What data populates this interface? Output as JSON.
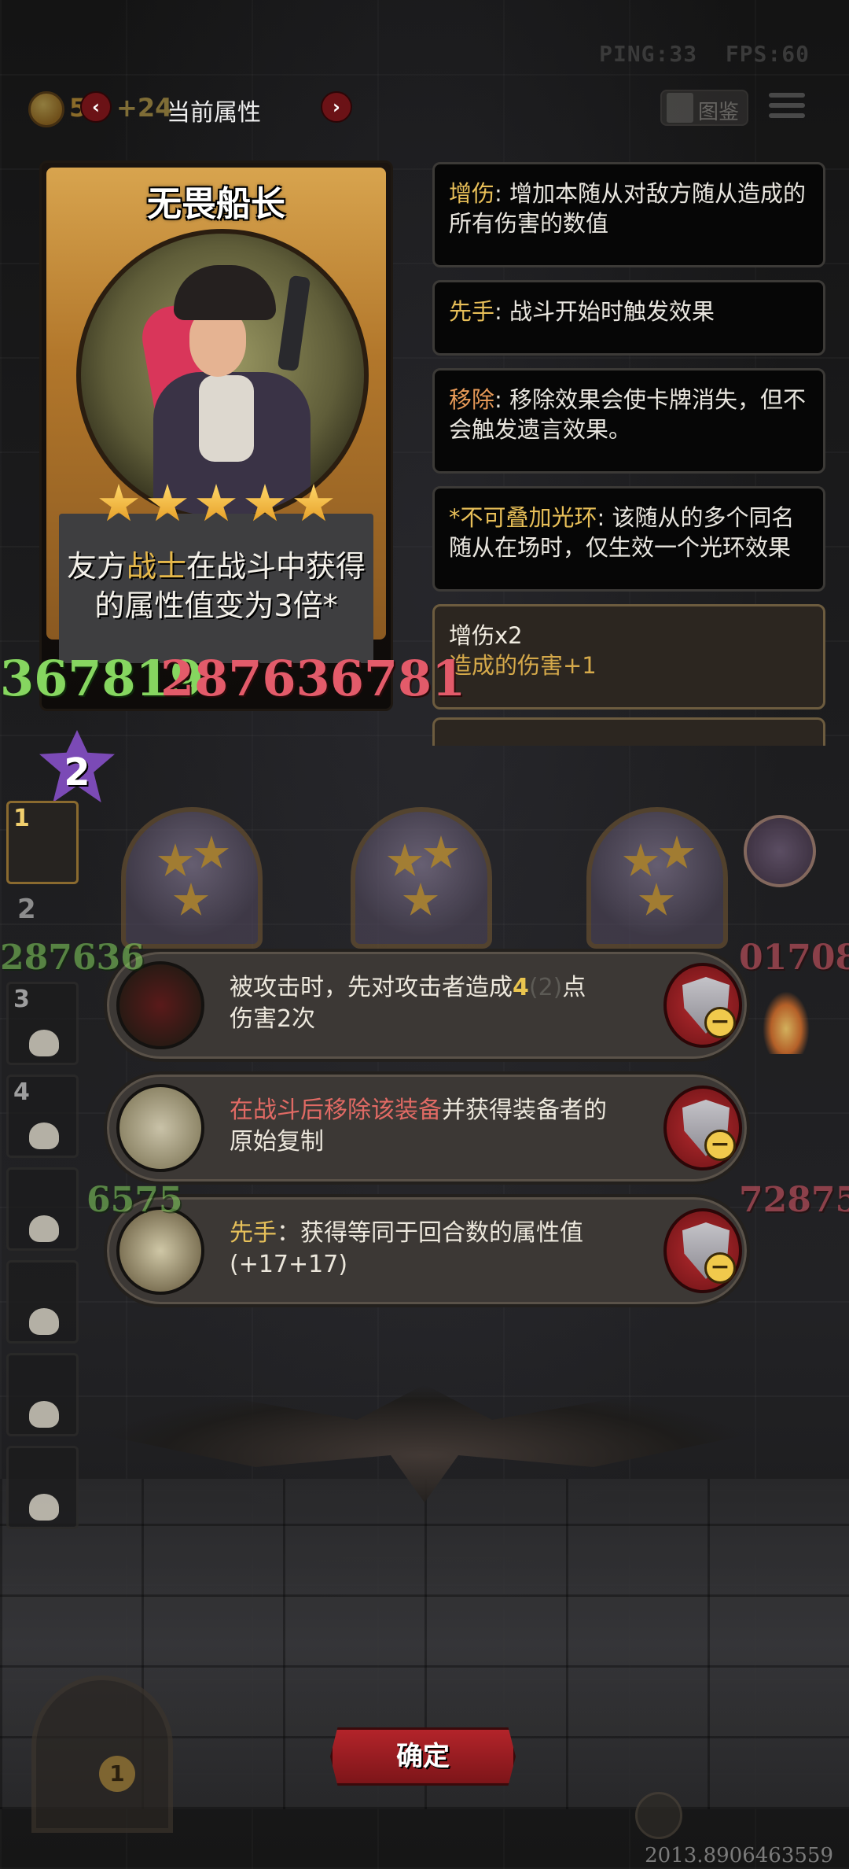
{
  "hud": {
    "ping": "PING:33",
    "fps": "FPS:60",
    "coins": "5",
    "coin_gain": "+24",
    "attr_title": "当前属性",
    "prev_icon": "chevron-left-icon",
    "next_icon": "chevron-right-icon",
    "codex_label": "图鉴",
    "menu_icon": "hamburger-menu-icon"
  },
  "card": {
    "name": "无畏船长",
    "stars": 5,
    "desc_pre": "友方",
    "desc_hl": "战士",
    "desc_post": "在战斗中获得",
    "desc_line2": "的属性值变为3倍*"
  },
  "floating_numbers": {
    "card_left": "367819",
    "card_mid": "287636781",
    "row_left": "287636",
    "row_right": "01708",
    "row2": "6575",
    "row2_right": "72875"
  },
  "keywords": [
    {
      "key": "增伤",
      "sep": ": ",
      "text": "增加本随从对敌方随从造成的所有伤害的数值"
    },
    {
      "key": "先手",
      "sep": ": ",
      "text": "战斗开始时触发效果"
    },
    {
      "key": "移除",
      "sep": ": ",
      "text": "移除效果会使卡牌消失，但不会触发遗言效果。"
    },
    {
      "key": "*不可叠加光环",
      "sep": ": ",
      "text": "该随从的多个同名随从在场时，仅生效一个光环效果"
    }
  ],
  "buff": {
    "line1": "增伤x2",
    "line2": "造成的伤害+1"
  },
  "board": {
    "round": "2",
    "slots": [
      "1",
      "2",
      "3",
      "4",
      "",
      "",
      "",
      ""
    ]
  },
  "equipment": [
    {
      "icon": "red-hood-icon",
      "seg1": "被攻击时，先对攻击者造成",
      "seg2": "4",
      "seg3": "(2)",
      "seg4": "点",
      "line2": "伤害2次"
    },
    {
      "icon": "quill-scroll-icon",
      "seg_red": "在战斗后移除该装备",
      "seg_rest": "并获得装备者的",
      "line2": "原始复制"
    },
    {
      "icon": "hourglass-icon",
      "key": "先手",
      "seg_rest": "：获得等同于回合数的属性值",
      "line2": "(+17+17)"
    }
  ],
  "remove_icon": "shield-minus-icon",
  "confirm_label": "确定",
  "door_coin": "1",
  "bottom_value": "2013.8906463559",
  "colors": {
    "accent_gold": "#e8bf58",
    "accent_red": "#b3242a",
    "card_frame": "#b2772b",
    "highlight_red_text": "#e06a64"
  }
}
